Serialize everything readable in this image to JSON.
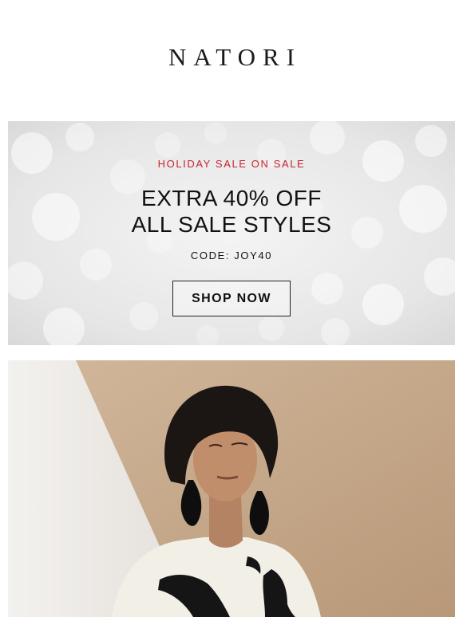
{
  "brand": {
    "logo_text": "NATORI"
  },
  "promo": {
    "eyebrow": "HOLIDAY SALE ON SALE",
    "headline_line1": "EXTRA 40% OFF",
    "headline_line2": "ALL SALE STYLES",
    "code_text": "CODE: JOY40",
    "cta_label": "SHOP NOW"
  },
  "colors": {
    "accent_red": "#c8242f",
    "text_dark": "#111111",
    "photo_background": "#c3a78b"
  },
  "images": {
    "hero_background": "silver-bokeh-pattern",
    "model_photo": "woman-with-black-bob-hair-and-black-earrings-in-white-embroidered-jacket"
  }
}
